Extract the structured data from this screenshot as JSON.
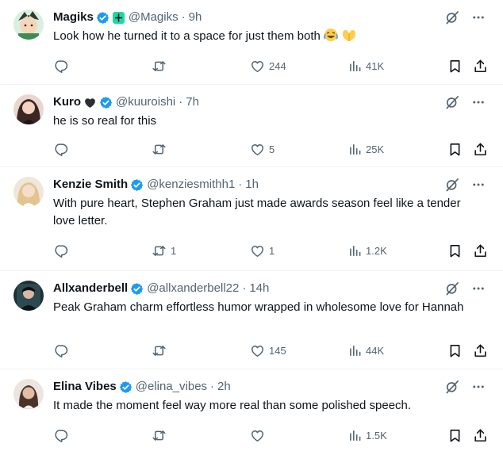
{
  "tweets": [
    {
      "name": "Magiks",
      "handle": "@Magiks",
      "time": "9h",
      "text": "Look how he turned it to a space for just them both",
      "replies": "",
      "retweets": "",
      "likes": "244",
      "views": "41K"
    },
    {
      "name": "Kuro",
      "handle": "@kuuroishi",
      "time": "7h",
      "text": "he is so real for this",
      "replies": "",
      "retweets": "",
      "likes": "5",
      "views": "25K"
    },
    {
      "name": "Kenzie Smith",
      "handle": "@kenziesmithh1",
      "time": "1h",
      "text": "With pure heart, Stephen Graham just made awards season feel like a tender love letter.",
      "replies": "",
      "retweets": "1",
      "likes": "1",
      "views": "1.2K"
    },
    {
      "name": "Allxanderbell",
      "handle": "@allxanderbell22",
      "time": "14h",
      "text": "Peak Graham charm effortless humor wrapped in wholesome love for Hannah",
      "replies": "",
      "retweets": "",
      "likes": "145",
      "views": "44K"
    },
    {
      "name": "Elina Vibes",
      "handle": "@elina_vibes",
      "time": "2h",
      "text": "It made the moment feel way more real than some polished speech.",
      "replies": "",
      "retweets": "",
      "likes": "",
      "views": "1.5K"
    }
  ],
  "icons": {
    "reply": "reply-icon",
    "retweet": "retweet-icon",
    "like": "heart-icon",
    "views": "views-icon",
    "bookmark": "bookmark-icon",
    "share": "share-icon",
    "grok": "grok-icon",
    "more": "more-icon",
    "verified": "verified-badge-icon"
  },
  "colors": {
    "verified": "#1d9bf0",
    "secondary_text": "#536471",
    "primary_text": "#0f1419",
    "divider": "#eff3f4"
  }
}
